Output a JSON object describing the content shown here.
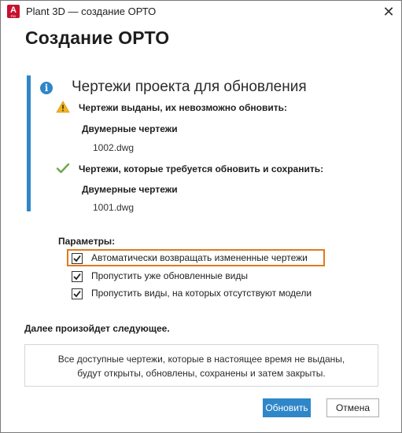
{
  "window": {
    "title": "Plant 3D — создание ОРТО",
    "app_icon_letter": "A",
    "app_icon_sub": "PID",
    "close_glyph": "✕"
  },
  "heading": "Создание ОРТО",
  "info": {
    "icon_glyph": "i",
    "title": "Чертежи проекта для обновления",
    "issued": {
      "status_icon": "warning-icon",
      "label": "Чертежи выданы, их невозможно обновить:",
      "category": "Двумерные чертежи",
      "file": "1002.dwg"
    },
    "to_update": {
      "status_icon": "checkmark-icon",
      "label": "Чертежи, которые требуется обновить и сохранить:",
      "category": "Двумерные чертежи",
      "file": "1001.dwg"
    }
  },
  "params": {
    "title": "Параметры:",
    "options": [
      {
        "label": "Автоматически возвращать измененные чертежи",
        "checked": true
      },
      {
        "label": "Пропустить уже обновленные виды",
        "checked": true
      },
      {
        "label": "Пропустить виды, на которых отсутствуют модели",
        "checked": true
      }
    ]
  },
  "next": {
    "title": "Далее произойдет следующее.",
    "line1": "Все доступные чертежи, которые в настоящее время не выданы,",
    "line2": "будут открыты, обновлены, сохранены и затем закрыты."
  },
  "buttons": {
    "update": "Обновить",
    "cancel": "Отмена"
  },
  "colors": {
    "accent": "#2f86c8",
    "highlight": "#e07a1f",
    "warning": "#f0b323",
    "success": "#6aa84f",
    "app_red": "#c8102e"
  }
}
